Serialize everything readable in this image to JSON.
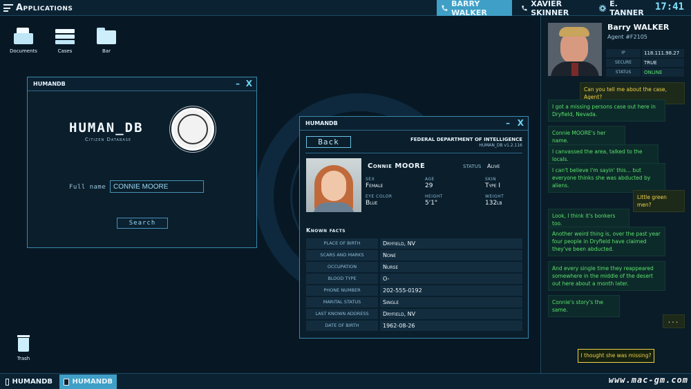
{
  "topbar": {
    "apps_label": "Applications",
    "contacts": [
      {
        "name": "BARRY WALKER",
        "active": true
      },
      {
        "name": "XAVIER SKINNER",
        "active": false
      },
      {
        "name": "E. TANNER",
        "active": false
      }
    ],
    "clock": "17:41"
  },
  "desktop": {
    "icons": [
      "Documents",
      "Cases",
      "Bar"
    ],
    "trash": "Trash"
  },
  "humandb_window": {
    "title": "HUMANDB",
    "minimize": "–",
    "close": "X",
    "logo": "HUMAN_DB",
    "subtitle": "Citizen Database",
    "full_name_label": "Full name",
    "full_name_value": "CONNIE MOORE",
    "search_label": "Search"
  },
  "record_window": {
    "title": "HUMANDB",
    "minimize": "–",
    "close": "X",
    "back_label": "Back",
    "agency": "FEDERAL DEPARTMENT OF INTELLIGENCE",
    "version": "HUMAN_DB    v1.2.116",
    "name": "Connie  MOORE",
    "status_label": "STATUS",
    "status_value": "Alive",
    "attributes": [
      {
        "label": "SEX",
        "value": "Female"
      },
      {
        "label": "AGE",
        "value": "29"
      },
      {
        "label": "SKIN",
        "value": "Type I"
      },
      {
        "label": "EYE COLOR",
        "value": "Blue"
      },
      {
        "label": "HEIGHT",
        "value": "5'1\""
      },
      {
        "label": "WEIGHT",
        "value": "132lb"
      }
    ],
    "known_facts_label": "Known  facts",
    "facts": [
      {
        "label": "PLACE OF BIRTH",
        "value": "Dryfield, NV"
      },
      {
        "label": "SCARS AND MARKS",
        "value": "None"
      },
      {
        "label": "OCCUPATION",
        "value": "Nurse"
      },
      {
        "label": "BLOOD TYPE",
        "value": "O-"
      },
      {
        "label": "PHONE NUMBER",
        "value": "202-555-0192"
      },
      {
        "label": "MARITAL STATUS",
        "value": "Single"
      },
      {
        "label": "LAST KNOWN ADDRESS",
        "value": "Dryfield, NV"
      },
      {
        "label": "DATE OF BIRTH",
        "value": "1962-08-26"
      }
    ]
  },
  "chat": {
    "agent_name": "Barry WALKER",
    "agent_id": "Agent #F2105",
    "info": [
      {
        "k": "IP",
        "v": "118.111.98.27"
      },
      {
        "k": "SECURE",
        "v": "TRUE"
      },
      {
        "k": "STATUS",
        "v": "ONLINE"
      }
    ],
    "messages": [
      {
        "text": "Can you tell me about the case, Agent?",
        "me": true
      },
      {
        "text": "I got a missing persons case out here in Dryfield, Nevada.",
        "me": false
      },
      {
        "text": "Connie MOORE's her name.",
        "me": false
      },
      {
        "text": "I canvassed the area, talked to the locals.",
        "me": false
      },
      {
        "text": "I can't believe I'm sayin' this... but everyone thinks she was abducted by aliens.",
        "me": false
      },
      {
        "text": "Little green men?",
        "me": true
      },
      {
        "text": "Look, I think it's bonkers too.",
        "me": false
      },
      {
        "text": "Another weird thing is, over the past year four people in Dryfield have claimed they've been abducted.",
        "me": false
      },
      {
        "text": "And every single time they reappeared somewhere in the middle of the desert out here about a month later.",
        "me": false
      },
      {
        "text": "Connie's story's the same.",
        "me": false
      }
    ],
    "ellipsis": "...",
    "reply_option": "I thought she was missing?"
  },
  "taskbar": {
    "tasks": [
      {
        "label": "HUMANDB",
        "active": false
      },
      {
        "label": "HUMANDB",
        "active": true
      }
    ],
    "watermark": "www.mac-gm.com"
  },
  "colors": {
    "accent": "#3f9fc6",
    "chat_green": "#59e36b",
    "chat_yellow": "#f2d24b",
    "background": "#071824"
  }
}
